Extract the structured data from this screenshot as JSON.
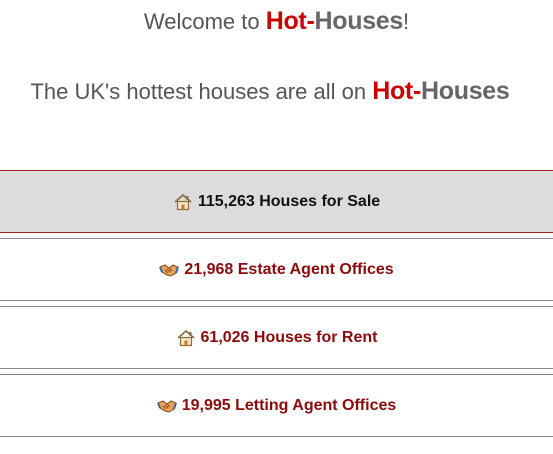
{
  "welcome": {
    "prefix": "Welcome to ",
    "brand_hot": "Hot",
    "brand_dash": "-",
    "brand_houses": "Houses",
    "suffix": "!"
  },
  "tagline": {
    "text": "The UK's hottest houses are all on ",
    "brand_hot": "Hot",
    "brand_dash": "-",
    "brand_houses": "Houses"
  },
  "nav": {
    "items": [
      {
        "label": "115,263 Houses for Sale",
        "icon": "house-icon",
        "active": true
      },
      {
        "label": "21,968 Estate Agent Offices",
        "icon": "handshake-icon",
        "active": false
      },
      {
        "label": "61,026 Houses for Rent",
        "icon": "house-icon",
        "active": false
      },
      {
        "label": "19,995 Letting Agent Offices",
        "icon": "handshake-icon",
        "active": false
      }
    ]
  },
  "colors": {
    "brand_red": "#cc0000",
    "link_red": "#8b0a0a",
    "active_bg": "#dcdcdc"
  }
}
